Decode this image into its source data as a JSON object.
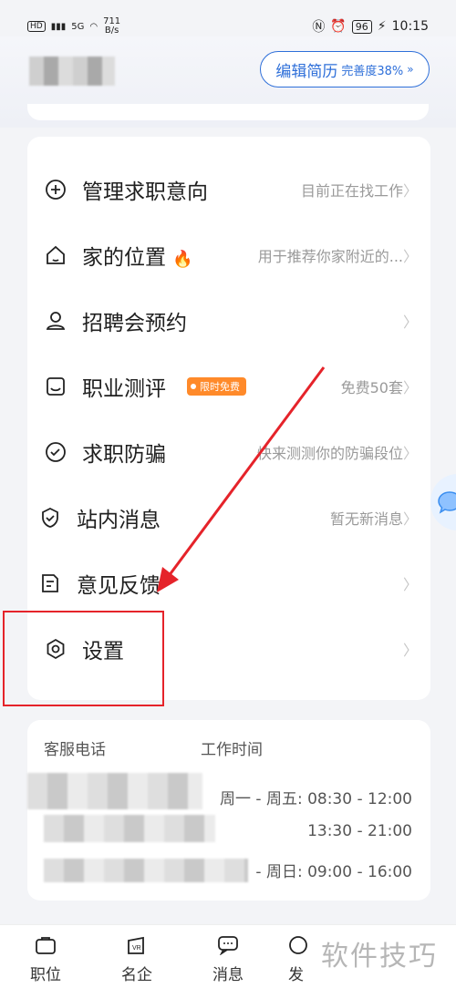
{
  "status_bar": {
    "left_hd": "HD",
    "left_signal": "5G",
    "net_speed_value": "711",
    "net_speed_unit": "B/s",
    "battery": "96",
    "time": "10:15"
  },
  "header": {
    "edit_resume_label": "编辑简历",
    "completeness_label": "完善度38%"
  },
  "menu": {
    "items": [
      {
        "label": "管理求职意向",
        "hint": "目前正在找工作",
        "icon": "plus-circle-icon"
      },
      {
        "label": "家的位置",
        "hint": "用于推荐你家附近的...",
        "icon": "home-icon",
        "emoji": "🔥"
      },
      {
        "label": "招聘会预约",
        "hint": "",
        "icon": "person-icon"
      },
      {
        "label": "职业测评",
        "hint": "免费50套",
        "icon": "assessment-icon",
        "badge": "限时免费"
      },
      {
        "label": "求职防骗",
        "hint": "快来测测你的防骗段位",
        "icon": "shield-check-icon"
      },
      {
        "label": "站内消息",
        "hint": "暂无新消息",
        "icon": "message-check-icon"
      },
      {
        "label": "意见反馈",
        "hint": "",
        "icon": "feedback-icon"
      },
      {
        "label": "设置",
        "hint": "",
        "icon": "settings-icon"
      }
    ]
  },
  "contact": {
    "phone_header": "客服电话",
    "hours_header": "工作时间",
    "rows": [
      {
        "time": "周一 - 周五:  08:30 - 12:00"
      },
      {
        "time": "13:30 - 21:00"
      },
      {
        "time": "- 周日:  09:00 - 16:00"
      }
    ]
  },
  "tabbar": {
    "tabs": [
      {
        "label": "职位",
        "icon": "briefcase-icon"
      },
      {
        "label": "名企",
        "icon": "company-icon"
      },
      {
        "label": "消息",
        "icon": "chat-icon"
      },
      {
        "label": "发",
        "icon": "discover-icon"
      }
    ]
  },
  "watermark": "软件技巧",
  "colors": {
    "accent": "#2e6fd9",
    "highlight": "#e5232a",
    "badge": "#ff8a2a"
  }
}
